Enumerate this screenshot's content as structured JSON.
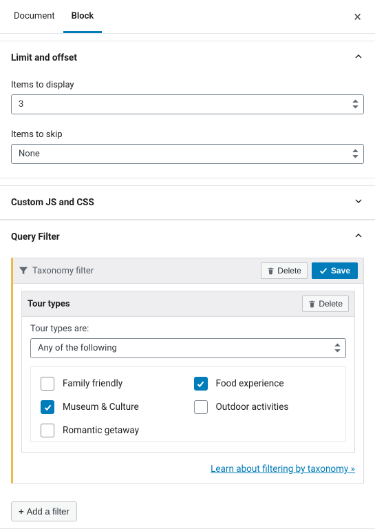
{
  "tabs": {
    "document": "Document",
    "block": "Block"
  },
  "sections": {
    "limit": {
      "title": "Limit and offset",
      "items_display_label": "Items to display",
      "items_display_value": "3",
      "items_skip_label": "Items to skip",
      "items_skip_value": "None"
    },
    "custom": {
      "title": "Custom JS and CSS"
    },
    "query": {
      "title": "Query Filter"
    }
  },
  "filter": {
    "title": "Taxonomy filter",
    "delete": "Delete",
    "save": "Save",
    "tour_types_heading": "Tour types",
    "condition_label": "Tour types are:",
    "condition_value": "Any of the following",
    "options": [
      {
        "label": "Family friendly",
        "checked": false
      },
      {
        "label": "Food experience",
        "checked": true
      },
      {
        "label": "Museum & Culture",
        "checked": true
      },
      {
        "label": "Outdoor activities",
        "checked": false
      },
      {
        "label": "Romantic getaway",
        "checked": false
      }
    ],
    "learn_link": "Learn about filtering by taxonomy »",
    "add_filter": "Add a filter"
  }
}
